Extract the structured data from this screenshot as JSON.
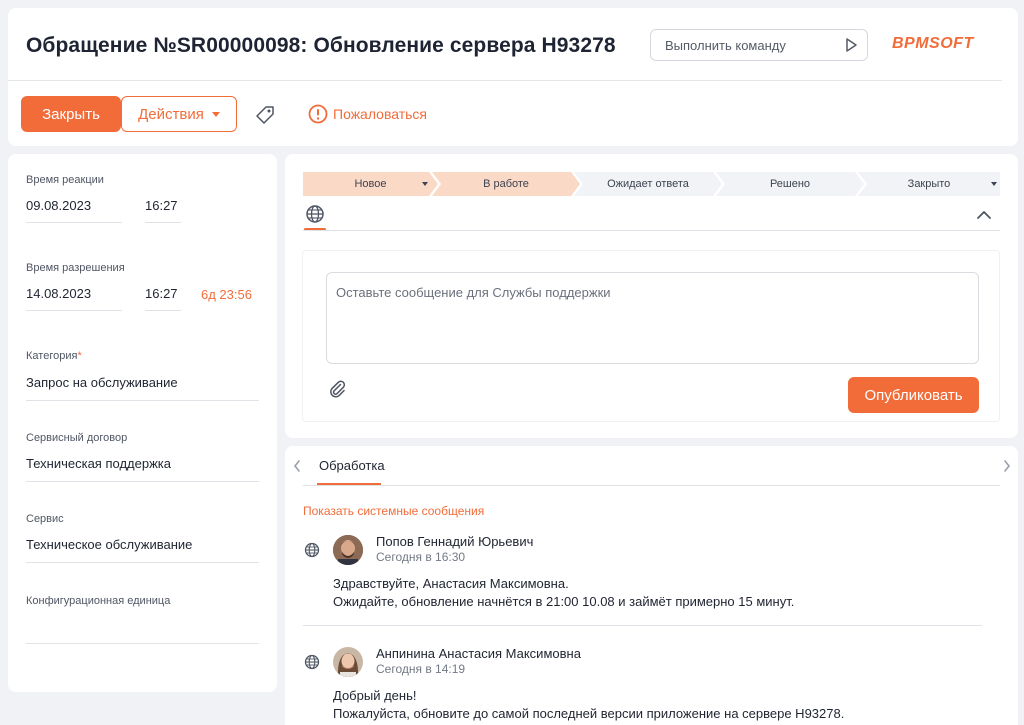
{
  "header": {
    "title": "Обращение №SR00000098: Обновление сервера H93278",
    "command_placeholder": "Выполнить команду",
    "logo": "BPMSOFT",
    "close_label": "Закрыть",
    "actions_label": "Действия",
    "complain_label": "Пожаловаться"
  },
  "left": {
    "reaction_label": "Время реакции",
    "reaction_date": "09.08.2023",
    "reaction_time": "16:27",
    "resolution_label": "Время разрешения",
    "resolution_date": "14.08.2023",
    "resolution_time": "16:27",
    "resolution_remaining": "6д 23:56",
    "category_label": "Категория",
    "category_required": "*",
    "category_value": "Запрос на обслуживание",
    "contract_label": "Сервисный договор",
    "contract_value": "Техническая поддержка",
    "service_label": "Сервис",
    "service_value": "Техническое обслуживание",
    "ci_label": "Конфигурационная единица",
    "ci_value": ""
  },
  "stages": [
    {
      "label": "Новое",
      "state": "done",
      "dropdown": true
    },
    {
      "label": "В работе",
      "state": "done",
      "dropdown": false
    },
    {
      "label": "Ожидает ответа",
      "state": "todo",
      "dropdown": false
    },
    {
      "label": "Решено",
      "state": "todo",
      "dropdown": false
    },
    {
      "label": "Закрыто",
      "state": "todo",
      "dropdown": true
    }
  ],
  "composer": {
    "placeholder": "Оставьте сообщение для Службы поддержки",
    "publish_label": "Опубликовать"
  },
  "feed": {
    "tab_label": "Обработка",
    "system_link": "Показать системные сообщения",
    "posts": [
      {
        "author": "Попов Геннадий Юрьевич",
        "time": "Сегодня в 16:30",
        "line1": "Здравствуйте, Анастасия Максимовна.",
        "line2": "Ожидайте, обновление начнётся в 21:00 10.08 и займёт примерно 15 минут."
      },
      {
        "author": "Анпинина Анастасия Максимовна",
        "time": "Сегодня в 14:19",
        "line1": "Добрый день!",
        "line2": "Пожалуйста, обновите до самой последней версии приложение на сервере H93278."
      }
    ]
  },
  "colors": {
    "accent": "#f26c3a",
    "stage_done": "#fbd9c7",
    "stage_todo": "#f1f3f6"
  }
}
